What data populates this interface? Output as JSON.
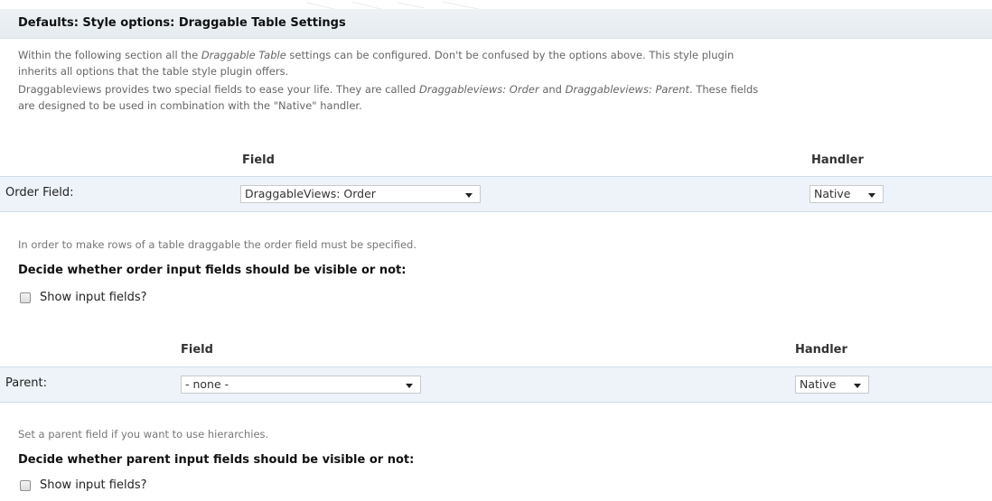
{
  "header": {
    "title": "Defaults: Style options: Draggable Table Settings"
  },
  "intro": {
    "line1_part1": "Within the following section all the ",
    "line1_em": "Draggable Table",
    "line1_part2": " settings can be configured. Don't be confused by the options above. This style plugin",
    "line2": "inherits all options that the table style plugin offers.",
    "line3_part1": "Draggableviews provides two special fields to ease your life. They are called ",
    "line3_em1": "Draggableviews: Order",
    "line3_and": " and ",
    "line3_em2": "Draggableviews: Parent",
    "line3_part2": ". These fields",
    "line4": "are designed to be used in combination with the \"Native\" handler."
  },
  "order_table": {
    "field_header": "Field",
    "handler_header": "Handler",
    "row_label": "Order Field:",
    "field_value": "DraggableViews: Order",
    "handler_value": "Native",
    "help": "In order to make rows of a table draggable the order field must be specified."
  },
  "order_visibility": {
    "heading": "Decide whether order input fields should be visible or not:",
    "checkbox_label": "Show input fields?",
    "checked": false
  },
  "parent_table": {
    "field_header": "Field",
    "handler_header": "Handler",
    "row_label": "Parent:",
    "field_value": "- none -",
    "handler_value": "Native",
    "help": "Set a parent field if you want to use hierarchies."
  },
  "parent_visibility": {
    "heading": "Decide whether parent input fields should be visible or not:",
    "checkbox_label": "Show input fields?",
    "checked": false
  }
}
